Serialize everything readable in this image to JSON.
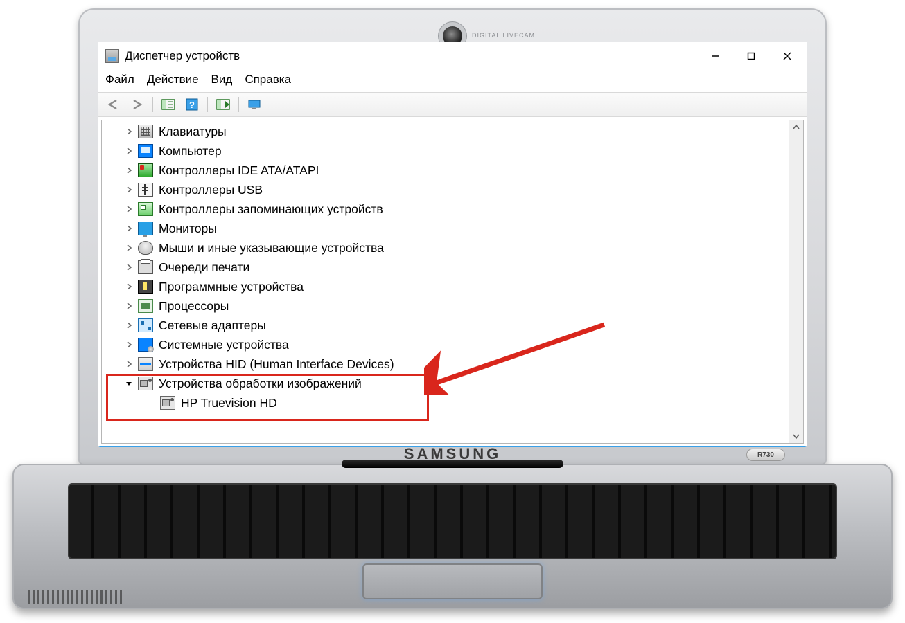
{
  "laptop": {
    "brand": "SAMSUNG",
    "model": "R730",
    "webcam_label": "DIGITAL LIVECAM"
  },
  "window": {
    "title": "Диспетчер устройств",
    "menus": {
      "file": "Файл",
      "action": "Действие",
      "view": "Вид",
      "help": "Справка"
    }
  },
  "tree": {
    "items": [
      {
        "icon": "keyboard",
        "label": "Клавиатуры"
      },
      {
        "icon": "computer",
        "label": "Компьютер"
      },
      {
        "icon": "ide",
        "label": "Контроллеры IDE ATA/ATAPI"
      },
      {
        "icon": "usb",
        "label": "Контроллеры USB"
      },
      {
        "icon": "storage",
        "label": "Контроллеры запоминающих устройств"
      },
      {
        "icon": "monitor",
        "label": "Мониторы"
      },
      {
        "icon": "mouse",
        "label": "Мыши и иные указывающие устройства"
      },
      {
        "icon": "printer",
        "label": "Очереди печати"
      },
      {
        "icon": "software",
        "label": "Программные устройства"
      },
      {
        "icon": "cpu",
        "label": "Процессоры"
      },
      {
        "icon": "net",
        "label": "Сетевые адаптеры"
      },
      {
        "icon": "system",
        "label": "Системные устройства"
      },
      {
        "icon": "hid",
        "label": "Устройства HID (Human Interface Devices)"
      }
    ],
    "expanded": {
      "icon": "camera",
      "label": "Устройства обработки изображений",
      "child": {
        "icon": "camera",
        "label": "HP Truevision HD"
      }
    }
  }
}
